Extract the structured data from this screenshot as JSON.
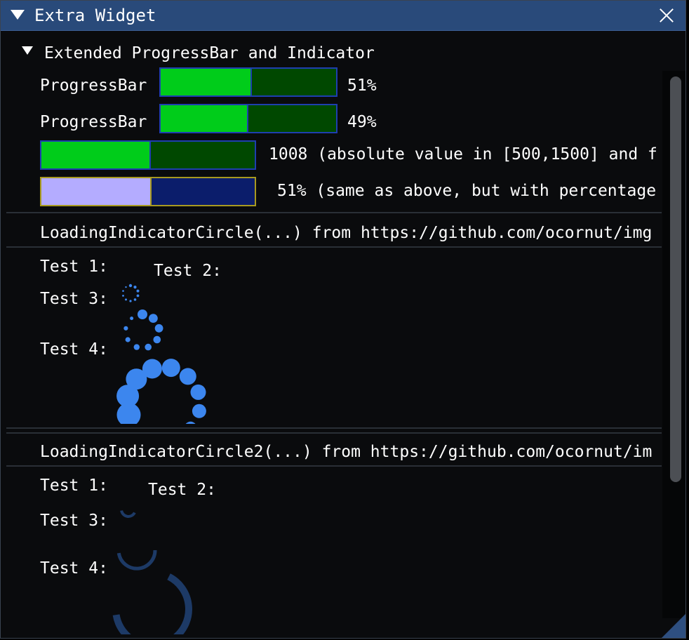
{
  "window": {
    "title": "Extra Widget"
  },
  "section": {
    "header": "Extended ProgressBar and Indicator"
  },
  "progress_bars": [
    {
      "label": "ProgressBar",
      "value_text": "51%",
      "fraction": 0.51
    },
    {
      "label": "ProgressBar",
      "value_text": "49%",
      "fraction": 0.49
    },
    {
      "value_text": "1008 (absolute value in [500,1500] and f",
      "fraction": 0.508
    },
    {
      "value_text": "51% (same as above, but with percentage",
      "fraction": 0.51
    }
  ],
  "circle_section": {
    "title": "LoadingIndicatorCircle(...) from https://github.com/ocornut/img",
    "tests": [
      "Test 1:",
      "Test 2:",
      "Test 3:",
      "Test 4:"
    ]
  },
  "circle2_section": {
    "title": "LoadingIndicatorCircle2(...) from https://github.com/ocornut/im",
    "tests": [
      "Test 1:",
      "Test 2:",
      "Test 3:",
      "Test 4:"
    ]
  },
  "colors": {
    "indicator_blue": "#3c86ee",
    "indicator2_dark": "#1d3a66",
    "bar_green": "#00cc1a",
    "bar_dark_green": "#004800",
    "bar_lavender": "#b4acff",
    "bar_navy": "#0b1d6b",
    "titlebar": "#294a7a"
  }
}
